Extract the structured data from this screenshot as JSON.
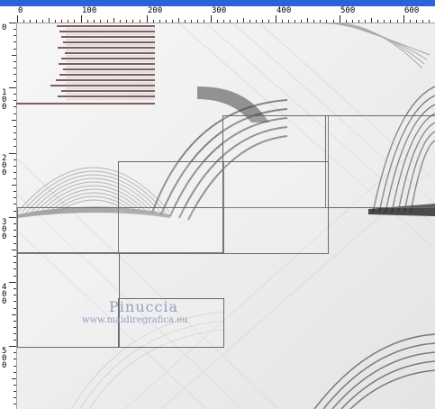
{
  "ruler": {
    "horizontal": [
      "0",
      "100",
      "200",
      "300",
      "400",
      "500",
      "600"
    ],
    "vertical": [
      "0",
      "100",
      "200",
      "300",
      "400",
      "500"
    ]
  },
  "watermark": {
    "name": "Pinuccia",
    "url": "www.maidiregrafica.eu"
  },
  "colors": {
    "titlebar": "#2a63d8",
    "ruler_bg": "#ffffff",
    "canvas_bg": "#f0f0f0",
    "panel_border": "#6a6a6a",
    "watermark": "#8fa2c3",
    "layer_line_dark": "#5a2a2a"
  }
}
